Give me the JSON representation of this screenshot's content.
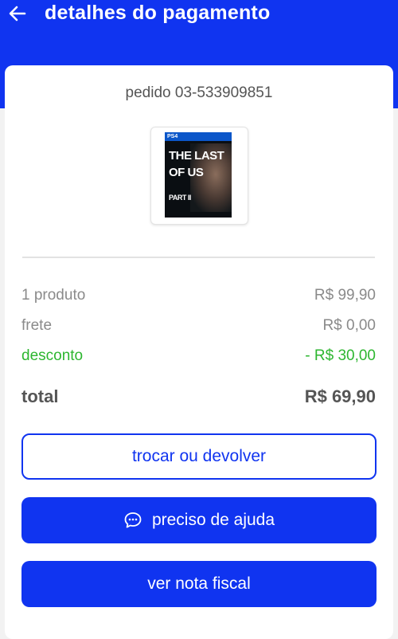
{
  "header": {
    "title": "detalhes do pagamento",
    "back_icon": "arrow-left-icon",
    "bg_color": "#1034f0"
  },
  "order": {
    "id_label": "pedido 03-533909851",
    "product_image": {
      "platform": "PS4",
      "title_line1": "THE LAST",
      "title_line2": "OF US",
      "title_line3": "PART II"
    }
  },
  "summary": {
    "products_label": "1 produto",
    "products_value": "R$ 99,90",
    "shipping_label": "frete",
    "shipping_value": "R$ 0,00",
    "discount_label": "desconto",
    "discount_value": "- R$ 30,00",
    "total_label": "total",
    "total_value": "R$ 69,90",
    "discount_color": "#2db630"
  },
  "actions": {
    "exchange_label": "trocar ou devolver",
    "help_label": "preciso de ajuda",
    "help_icon": "chat-bubble-icon",
    "invoice_label": "ver nota fiscal"
  }
}
